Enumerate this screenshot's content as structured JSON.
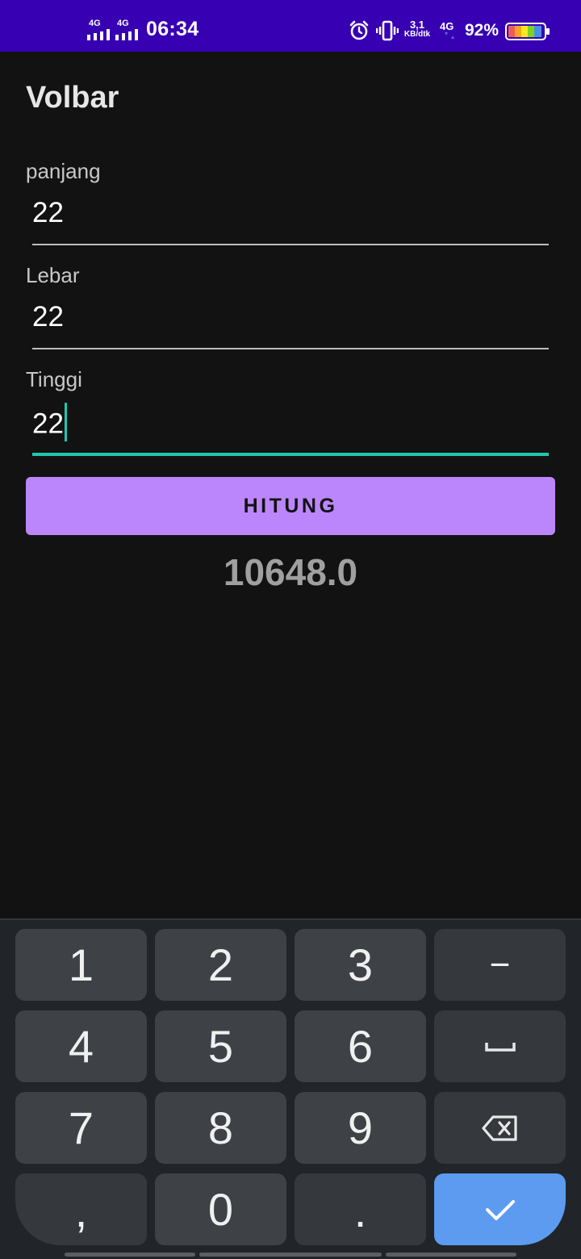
{
  "status_bar": {
    "sim1_network": "4G",
    "sim2_network": "4G",
    "time": "06:34",
    "speed_value": "3,1",
    "speed_unit": "KB/dtk",
    "data_network": "4G",
    "battery_percent": "92%",
    "battery_level": 0.92,
    "icons": [
      "signal-icon",
      "signal-icon",
      "alarm-icon",
      "vibrate-icon",
      "battery-icon"
    ]
  },
  "app": {
    "title": "Volbar",
    "fields": [
      {
        "label": "panjang",
        "value": "22"
      },
      {
        "label": "Lebar",
        "value": "22"
      },
      {
        "label": "Tinggi",
        "value": "22"
      }
    ],
    "button_label": "HITUNG",
    "result": "10648.0"
  },
  "keyboard": {
    "row1": [
      "1",
      "2",
      "3",
      "−"
    ],
    "row2": [
      "4",
      "5",
      "6"
    ],
    "row3": [
      "7",
      "8",
      "9"
    ],
    "row4": [
      ",",
      "0",
      "."
    ],
    "icons": [
      "space-icon",
      "backspace-icon",
      "checkmark-icon"
    ]
  },
  "colors": {
    "status_bar": "#3700b3",
    "background": "#121212",
    "accent": "#bb86fc",
    "focus": "#1fc8b0",
    "keyboard_bg": "#212428",
    "key_bg": "#3e4246",
    "done_key": "#5c9bf0"
  }
}
